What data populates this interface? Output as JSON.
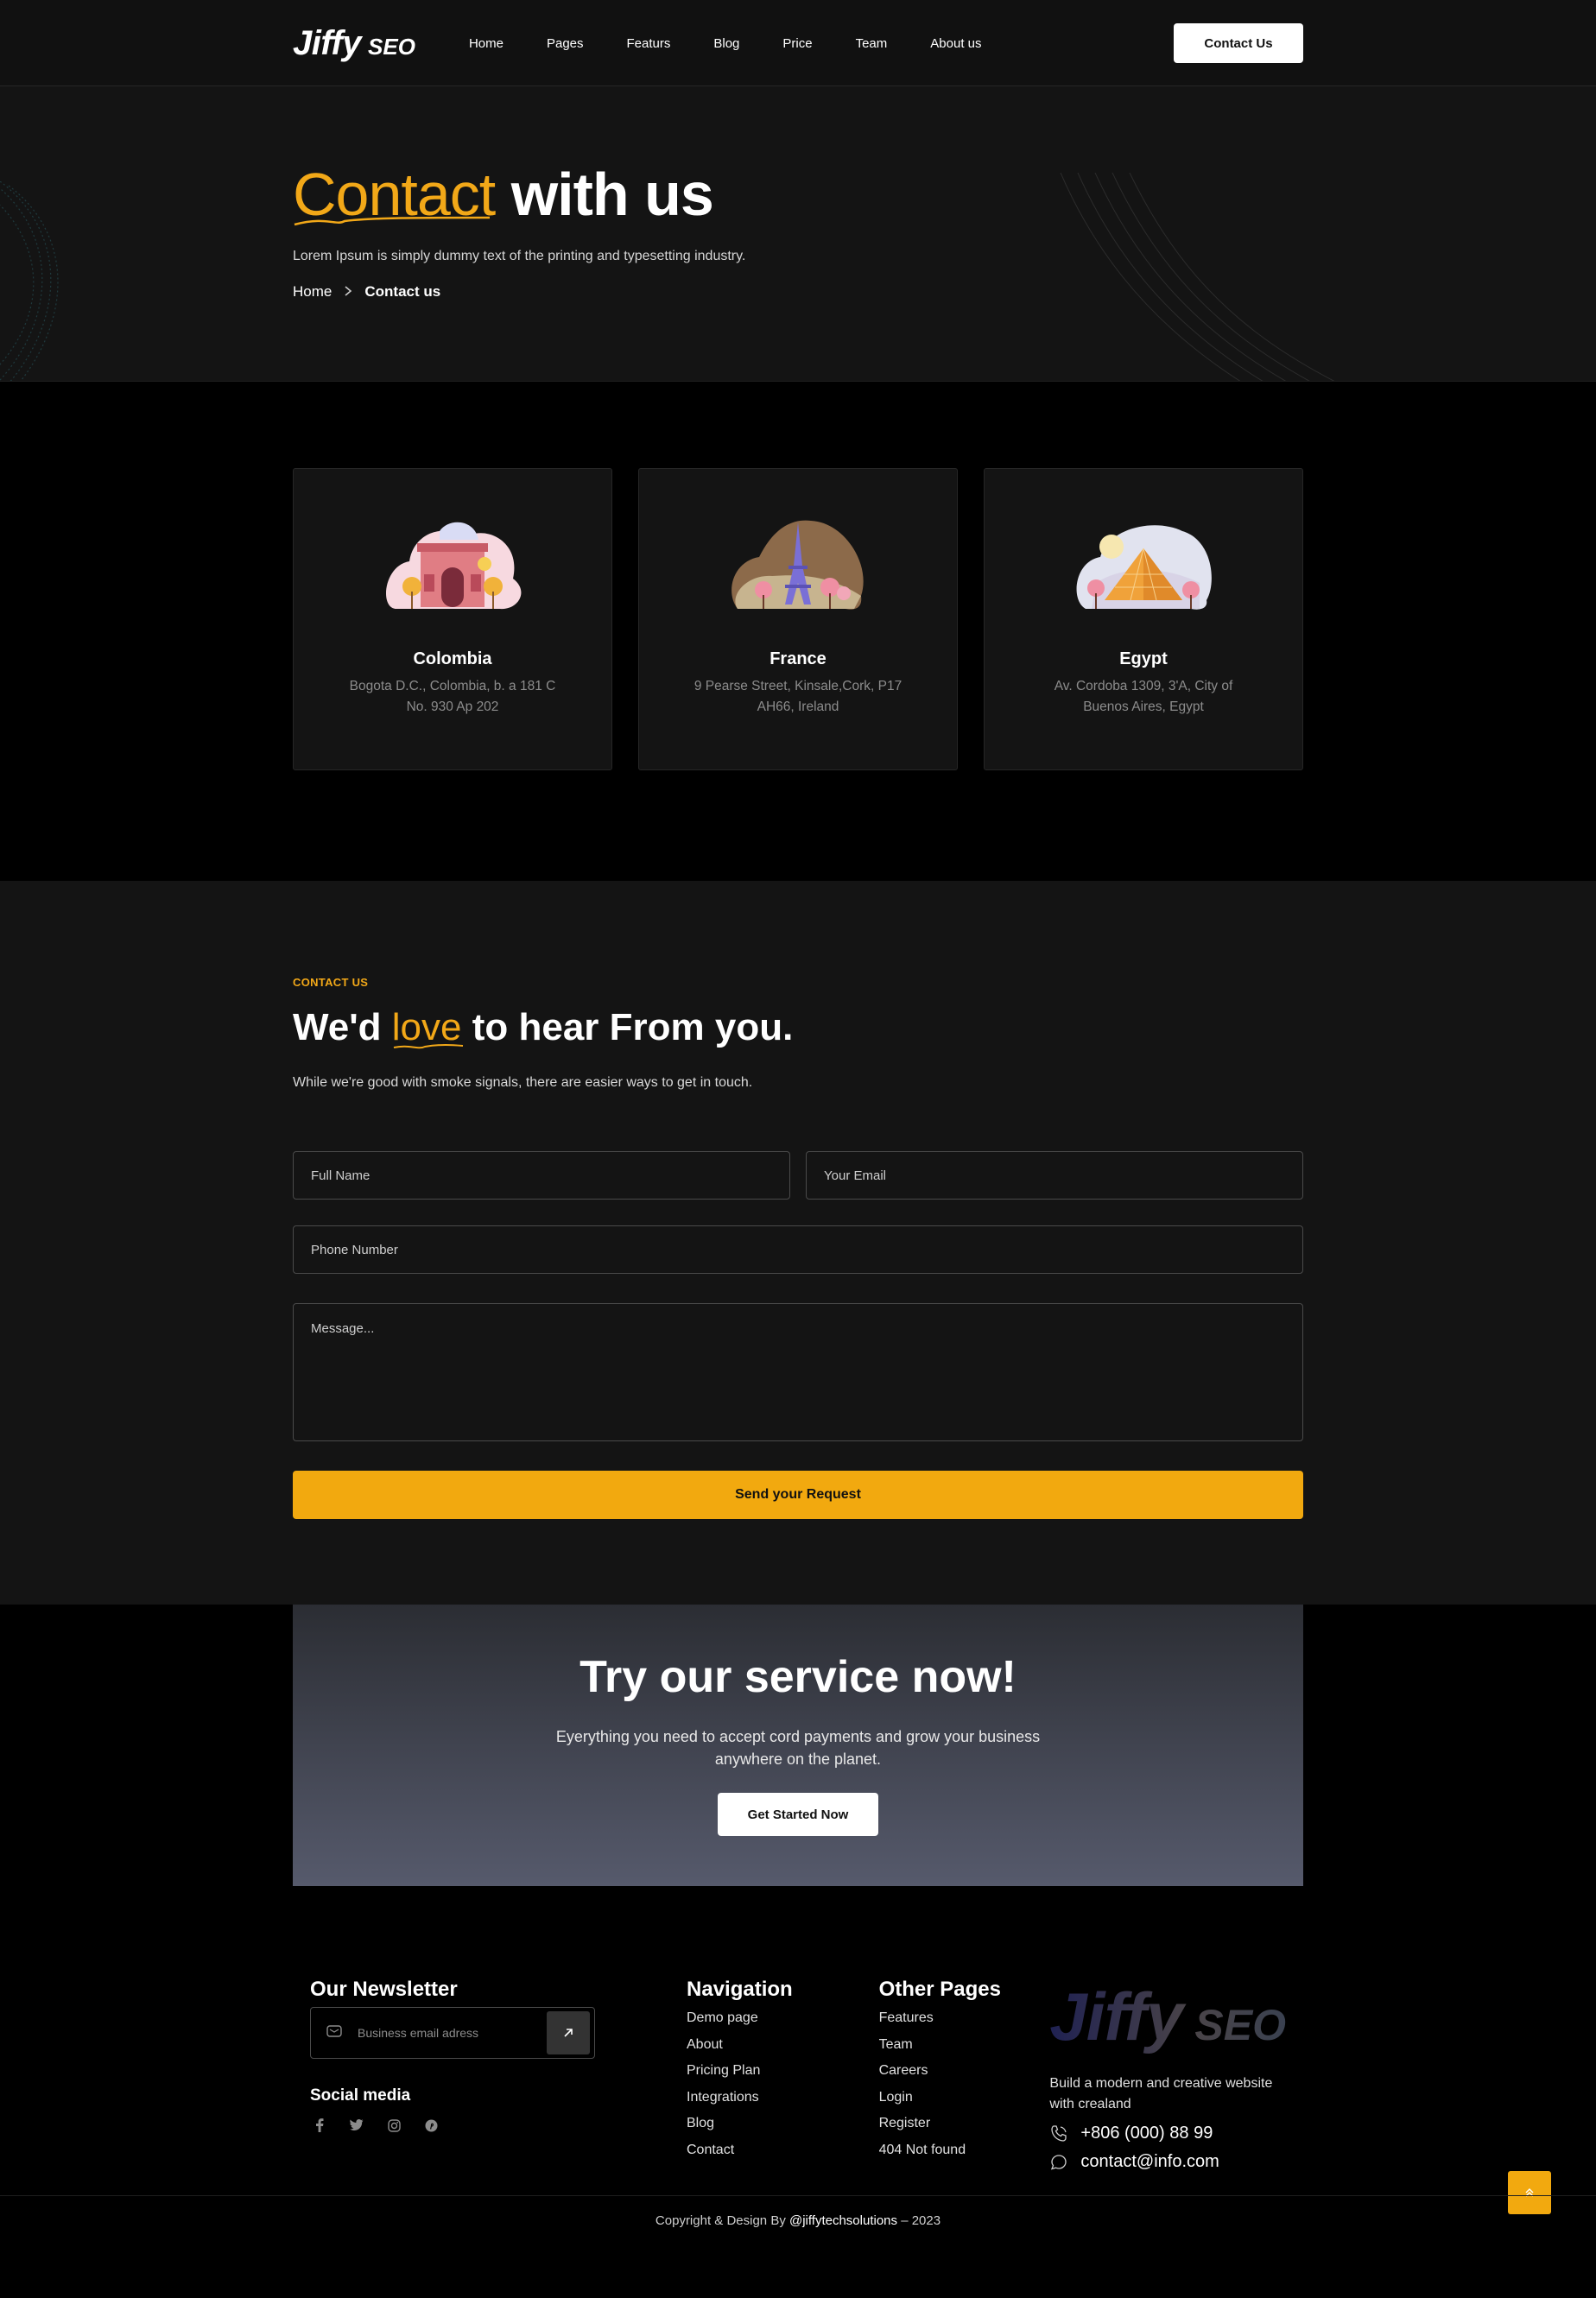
{
  "header": {
    "logo_main": "Jiffy",
    "logo_sub": "SEO",
    "nav": [
      "Home",
      "Pages",
      "Featurs",
      "Blog",
      "Price",
      "Team",
      "About us"
    ],
    "cta": "Contact Us"
  },
  "hero": {
    "title_accent": "Contact",
    "title_rest": "with us",
    "subtitle": "Lorem Ipsum is simply dummy text of the printing and typesetting industry.",
    "breadcrumb_home": "Home",
    "breadcrumb_current": "Contact us"
  },
  "locations": [
    {
      "country": "Colombia",
      "address": "Bogota D.C., Colombia, b. a 181 C No. 930 Ap 202",
      "icon": "arch-illustration"
    },
    {
      "country": "France",
      "address": "9 Pearse Street, Kinsale,Cork, P17 AH66, Ireland",
      "icon": "eiffel-tower-illustration"
    },
    {
      "country": "Egypt",
      "address": "Av. Cordoba 1309, 3'A, City of Buenos Aires, Egypt",
      "icon": "pyramid-illustration"
    }
  ],
  "contact": {
    "kicker": "CONTACT US",
    "title_pre": "We'd",
    "title_accent": "love",
    "title_post": "to hear From you.",
    "subtitle": "While we're good with smoke signals, there are easier ways to get in touch.",
    "placeholders": {
      "name": "Full Name",
      "email": "Your Email",
      "phone": "Phone Number",
      "message": "Message..."
    },
    "submit": "Send your Request"
  },
  "cta": {
    "title": "Try our service now!",
    "text": "Eyerything you need to accept cord payments and grow your business anywhere on the planet.",
    "button": "Get Started Now"
  },
  "footer": {
    "newsletter_title": "Our Newsletter",
    "newsletter_placeholder": "Business email adress",
    "social_title": "Social media",
    "social_icons": [
      "facebook-icon",
      "twitter-icon",
      "instagram-icon",
      "pinterest-icon"
    ],
    "nav_title": "Navigation",
    "nav_links": [
      "Demo page",
      "About",
      "Pricing Plan",
      "Integrations",
      "Blog",
      "Contact"
    ],
    "other_title": "Other Pages",
    "other_links": [
      "Features",
      "Team",
      "Careers",
      "Login",
      "Register",
      "404 Not found"
    ],
    "logo_main": "Jiffy",
    "logo_sub": "SEO",
    "description": "Build a modern and creative website with crealand",
    "phone": "+806 (000) 88 99",
    "email": "contact@info.com",
    "copyright_pre": "Copyright & Design By",
    "copyright_handle": "@jiffytechsolutions",
    "copyright_post": "– 2023"
  },
  "colors": {
    "accent": "#f2a818",
    "background": "#000000",
    "panel": "#141414"
  }
}
